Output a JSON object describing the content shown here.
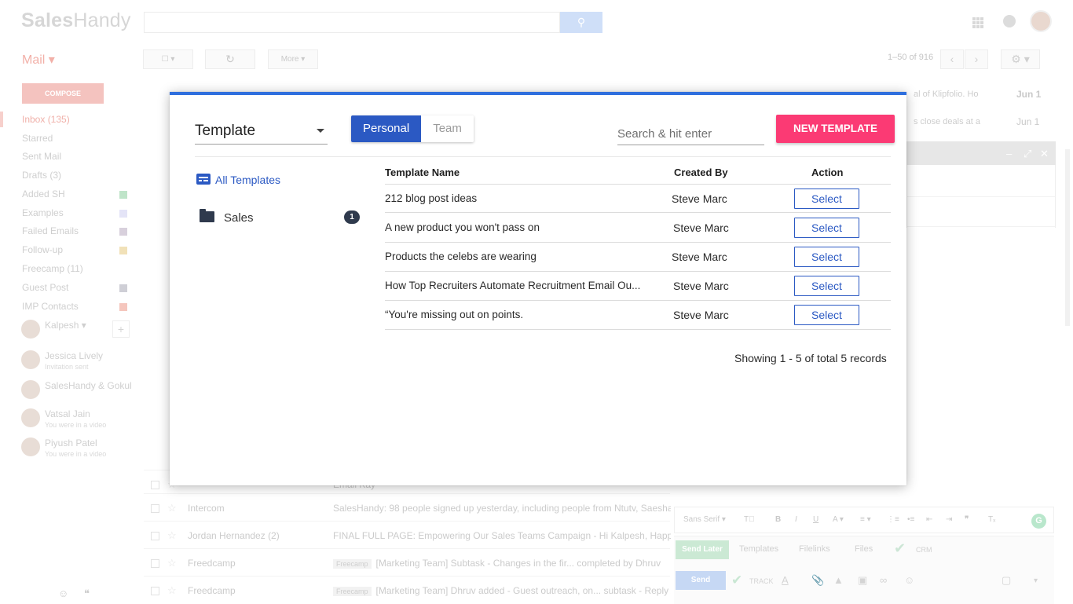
{
  "app": {
    "logo_bold": "Sales",
    "logo_light": "Handy"
  },
  "gmail": {
    "mail_label": "Mail ▾",
    "compose": "COMPOSE",
    "toolbar": {
      "more": "More ▾",
      "refresh_icon": "refresh-icon"
    },
    "pager": "1–50 of 916",
    "sidebar": [
      {
        "label": "Inbox (135)",
        "active": true
      },
      {
        "label": "Starred"
      },
      {
        "label": "Sent Mail"
      },
      {
        "label": "Drafts (3)"
      },
      {
        "label": "Added SH",
        "color": "#bfe4c9"
      },
      {
        "label": "Examples",
        "color": "#e4e4f7"
      },
      {
        "label": "Failed Emails",
        "color": "#d8d0dc"
      },
      {
        "label": "Follow-up",
        "color": "#f1e1b8"
      },
      {
        "label": "Freecamp (11)"
      },
      {
        "label": "Guest Post",
        "color": "#cfcfd6"
      },
      {
        "label": "IMP Contacts",
        "color": "#f5c6bd"
      }
    ],
    "chat": [
      {
        "name": "Kalpesh ▾",
        "sub": ""
      },
      {
        "name": "Jessica Lively",
        "sub": "Invitation sent"
      },
      {
        "name": "SalesHandy & Gokul",
        "sub": ""
      },
      {
        "name": "Vatsal Jain",
        "sub": "You were in a video"
      },
      {
        "name": "Piyush Patel",
        "sub": "You were in a video"
      }
    ],
    "right_rows": [
      {
        "text": "al of Klipfolio. Ho",
        "date": "Jun 1"
      },
      {
        "text": "s close deals at a",
        "date": "Jun 1"
      }
    ],
    "mail_rows": [
      {
        "sender": "",
        "label": "",
        "subject": "Email Kay"
      },
      {
        "sender": "Intercom",
        "label": "",
        "subject": "SalesHandy: 98 people signed up yesterday, including people from Ntutv, Saesha"
      },
      {
        "sender": "Jordan Hernandez (2)",
        "label": "",
        "subject": "FINAL FULL PAGE: Empowering Our Sales Teams Campaign - Hi Kalpesh, Happy Tu"
      },
      {
        "sender": "Freedcamp",
        "label": "Freecamp",
        "subject": "[Marketing Team] Subtask - Changes in the fir... completed by Dhruv"
      },
      {
        "sender": "Freedcamp",
        "label": "Freecamp",
        "subject": "[Marketing Team] Dhruv added - Guest outreach, on... subtask - Reply Al"
      }
    ],
    "compose_bar": {
      "font": "Sans Serif ▾",
      "send_later": "Send Later",
      "templates": "Templates",
      "filelinks": "Filelinks",
      "files": "Files",
      "crm": "CRM",
      "send": "Send",
      "track": "TRACK"
    }
  },
  "modal": {
    "template_dropdown": "Template",
    "toggle": {
      "personal": "Personal",
      "team": "Team"
    },
    "search_placeholder": "Search & hit enter",
    "new_template_button": "NEW TEMPLATE",
    "nav": {
      "all_templates": "All Templates",
      "folders": [
        {
          "label": "Sales",
          "count": "1"
        }
      ]
    },
    "table": {
      "headers": {
        "name": "Template Name",
        "created_by": "Created By",
        "action": "Action"
      },
      "rows": [
        {
          "name": "212 blog post ideas",
          "created_by": "Steve Marc",
          "action": "Select"
        },
        {
          "name": "A new product you won't pass on",
          "created_by": "Steve Marc",
          "action": "Select"
        },
        {
          "name": "Products the celebs are wearing",
          "created_by": "Steve Marc",
          "action": "Select"
        },
        {
          "name": "How Top Recruiters Automate Recruitment Email Ou...",
          "created_by": "Steve Marc",
          "action": "Select"
        },
        {
          "name": "“You're missing out on points.",
          "created_by": "Steve Marc",
          "action": "Select"
        }
      ]
    },
    "records_text": "Showing 1 - 5 of total 5 records"
  },
  "colors": {
    "accent_blue": "#2b59c3",
    "new_template_pink": "#fb3a74",
    "modal_top_border": "#2f6fde"
  }
}
